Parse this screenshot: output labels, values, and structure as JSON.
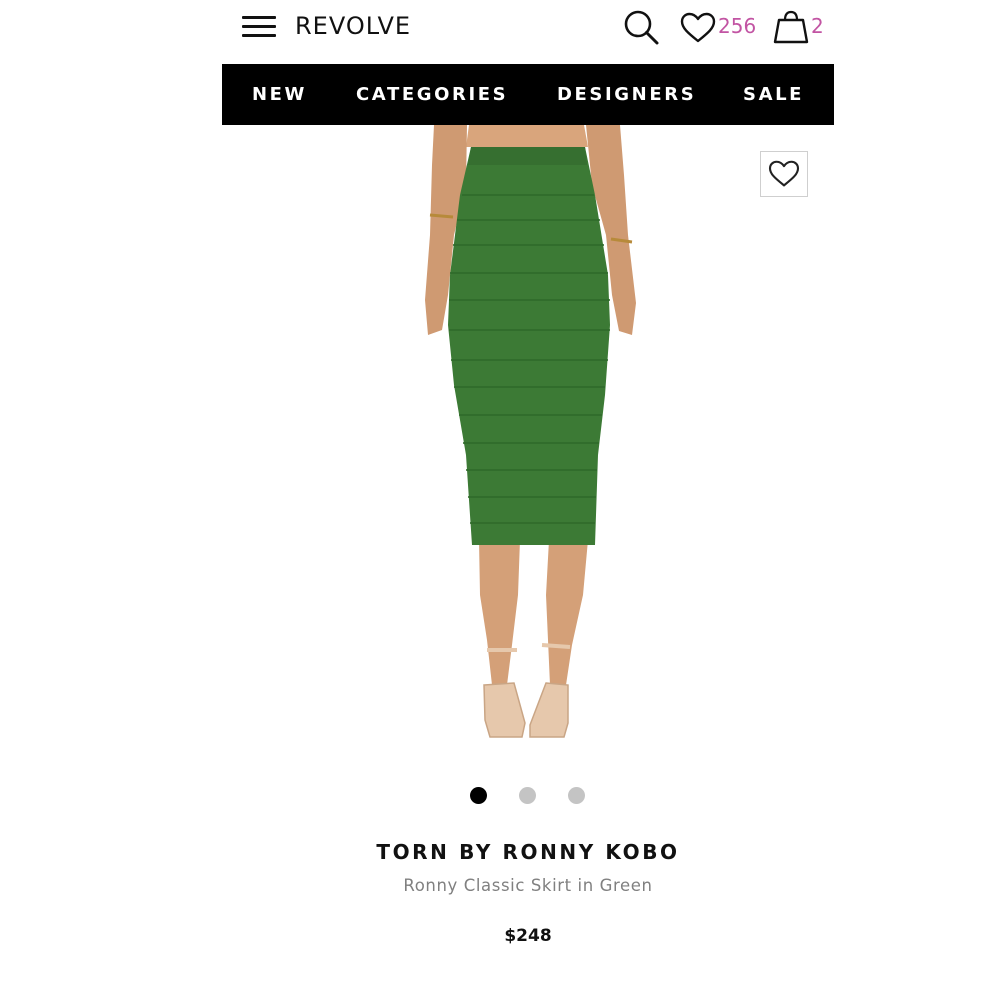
{
  "header": {
    "logo": "REVOLVE",
    "wishlist_count": "256",
    "bag_count": "2",
    "accent_color": "#c254a3"
  },
  "nav": {
    "items": [
      "NEW",
      "CATEGORIES",
      "DESIGNERS",
      "SALE"
    ]
  },
  "icons": {
    "menu": "hamburger-menu-icon",
    "search": "search-icon",
    "wishlist": "heart-icon",
    "bag": "shopping-bag-icon",
    "favorite": "heart-outline-icon"
  },
  "product": {
    "brand": "TORN BY RONNY KOBO",
    "name": "Ronny Classic Skirt in Green",
    "price": "$248",
    "image_color": "#3c7a35",
    "carousel": {
      "total": 3,
      "active": 1
    }
  }
}
